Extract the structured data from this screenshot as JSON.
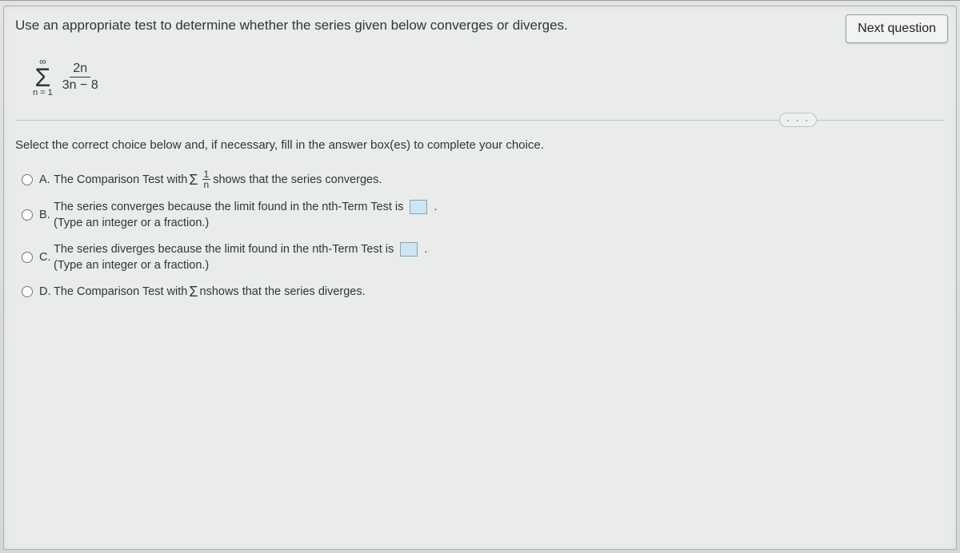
{
  "header": {
    "question_text": "Use an appropriate test to determine whether the series given below converges or diverges.",
    "next_button": "Next question"
  },
  "series": {
    "upper": "∞",
    "sigma": "Σ",
    "lower": "n = 1",
    "numerator": "2n",
    "denominator": "3n − 8"
  },
  "ellipsis": "· · ·",
  "instruction": "Select the correct choice below and, if necessary, fill in the answer box(es) to complete your choice.",
  "choices": {
    "a": {
      "label": "A.",
      "pre": "The Comparison Test with ",
      "sigma": "Σ",
      "frac_num": "1",
      "frac_den": "n",
      "post": " shows that the series converges."
    },
    "b": {
      "label": "B.",
      "line1_pre": "The series converges because the limit found in the nth-Term Test is ",
      "line1_post": ".",
      "line2": "(Type an integer or a fraction.)"
    },
    "c": {
      "label": "C.",
      "line1_pre": "The series diverges because the limit found in the nth-Term Test is ",
      "line1_post": ".",
      "line2": "(Type an integer or a fraction.)"
    },
    "d": {
      "label": "D.",
      "pre": "The Comparison Test with ",
      "sigma": "Σ",
      "term": "n",
      "post": " shows that the series diverges."
    }
  }
}
